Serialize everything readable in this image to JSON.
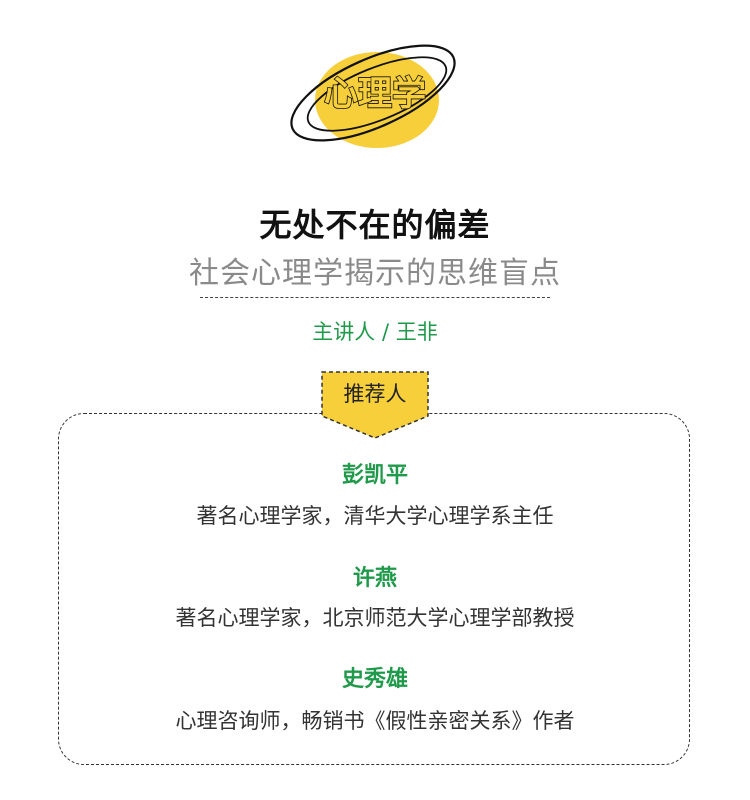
{
  "logo": {
    "text": "心理学",
    "accent_color": "#f7cf3b"
  },
  "title": "无处不在的偏差",
  "subtitle": "社会心理学揭示的思维盲点",
  "lecturer": "主讲人 / 王非",
  "recommenders": {
    "badge": "推荐人",
    "badge_color": "#f7cf3b",
    "items": [
      {
        "name": "彭凯平",
        "desc": "著名心理学家，清华大学心理学系主任"
      },
      {
        "name": "许燕",
        "desc": "著名心理学家，北京师范大学心理学部教授"
      },
      {
        "name": "史秀雄",
        "desc": "心理咨询师，畅销书《假性亲密关系》作者"
      }
    ]
  }
}
